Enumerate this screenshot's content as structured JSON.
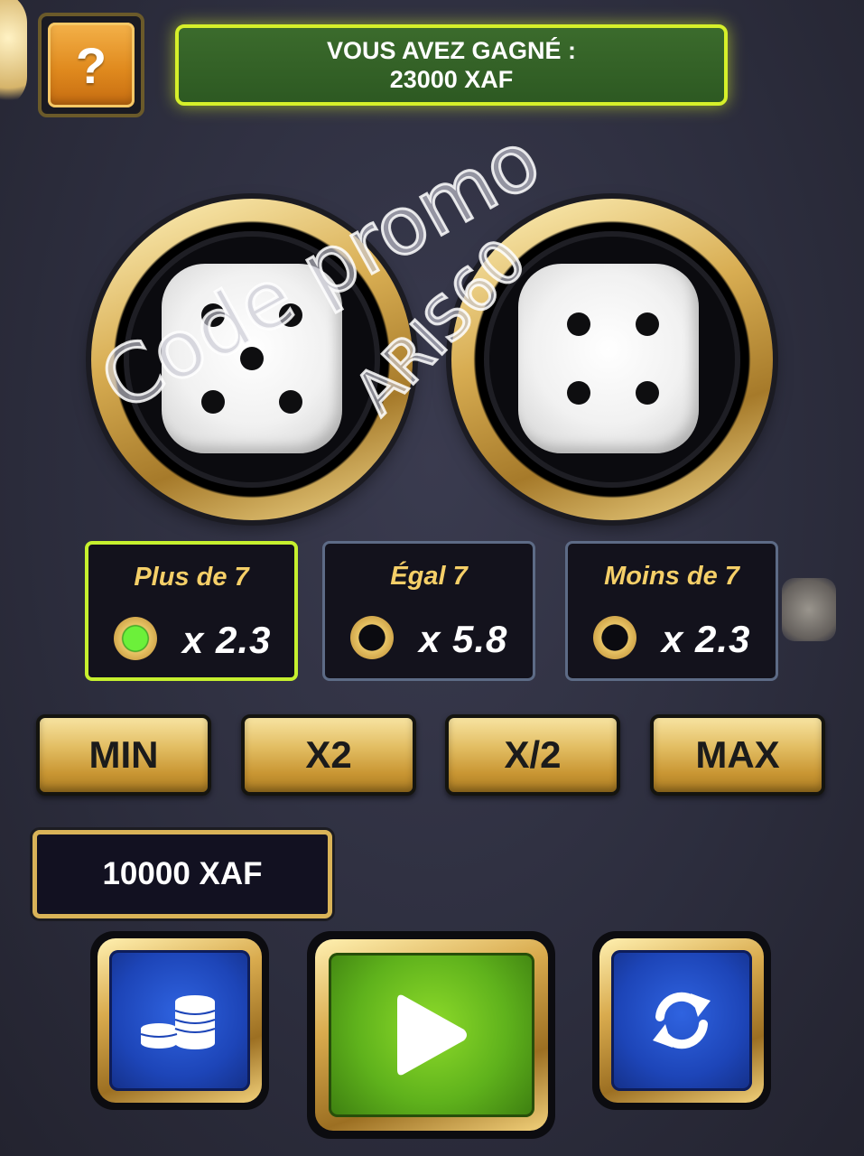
{
  "help_button": {
    "label": "?"
  },
  "win_banner": {
    "line1": "VOUS AVEZ GAGNÉ :",
    "line2": "23000 XAF"
  },
  "dice": [
    {
      "value": 5
    },
    {
      "value": 4
    }
  ],
  "bet_options": [
    {
      "title": "Plus de 7",
      "multiplier": "x 2.3",
      "selected": true
    },
    {
      "title": "Égal 7",
      "multiplier": "x 5.8",
      "selected": false
    },
    {
      "title": "Moins de 7",
      "multiplier": "x 2.3",
      "selected": false
    }
  ],
  "stake_buttons": [
    "MIN",
    "X2",
    "X/2",
    "MAX"
  ],
  "bet_amount": "10000 XAF",
  "action_buttons": {
    "left_icon": "coins-icon",
    "center_icon": "play-icon",
    "right_icon": "refresh-icon"
  },
  "watermark": {
    "line1": "Code promo",
    "line2": "ARIS60"
  },
  "colors": {
    "win_border": "#d6f02a",
    "selected_border": "#c6f02e",
    "option_title": "#f5cf68",
    "gold": "#d9b358",
    "blue_button": "#1d45b8",
    "green_button": "#5fb21c"
  }
}
